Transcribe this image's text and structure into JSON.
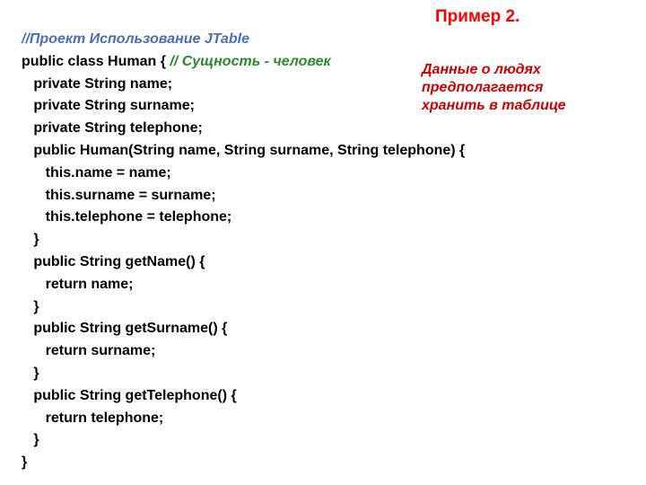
{
  "header": {
    "title": "Пример 2."
  },
  "side_note": {
    "line1": "Данные о людях",
    "line2": "предполагается",
    "line3": "хранить в таблице"
  },
  "code": {
    "comment_top": "//Проект Использование JTable",
    "line_class_prefix": "public class Human { ",
    "comment_entity": "// Сущность - человек",
    "line_name": "   private String name;",
    "line_surname": "   private String surname;",
    "line_telephone": "   private String telephone;",
    "line_ctor": "   public Human(String name, String surname, String telephone) {",
    "line_this_name": "      this.name = name;",
    "line_this_surname": "      this.surname = surname;",
    "line_this_telephone": "      this.telephone = telephone;",
    "line_close1": "   }",
    "line_getname": "   public String getName() {",
    "line_ret_name": "      return name;",
    "line_close2": "   }",
    "line_getsurname": "   public String getSurname() {",
    "line_ret_surname": "      return surname;",
    "line_close3": "   }",
    "line_gettelephone": "   public String getTelephone() {",
    "line_ret_telephone": "      return telephone;",
    "line_close4": "   }",
    "line_close5": "}"
  }
}
